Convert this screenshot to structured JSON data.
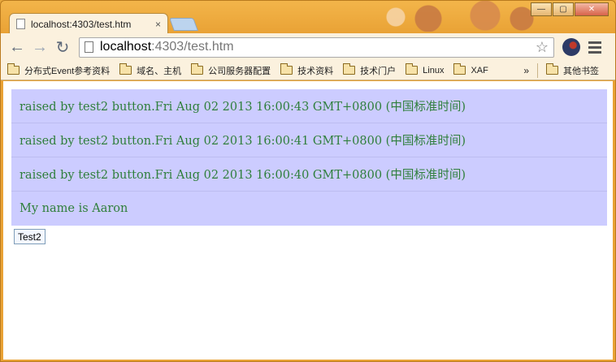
{
  "browser": {
    "tab_title": "localhost:4303/test.htm",
    "tab_close": "×",
    "url_host": "localhost",
    "url_rest": ":4303/test.htm"
  },
  "bookmarks": {
    "items": [
      "分布式Event参考资料",
      "域名、主机",
      "公司服务器配置",
      "技术资料",
      "技术门户",
      "Linux",
      "XAF"
    ],
    "overflow": "»",
    "other": "其他书签"
  },
  "page": {
    "messages": [
      "raised by test2 button.Fri Aug 02 2013 16:00:43 GMT+0800 (中国标准时间)",
      "raised by test2 button.Fri Aug 02 2013 16:00:41 GMT+0800 (中国标准时间)",
      "raised by test2 button.Fri Aug 02 2013 16:00:40 GMT+0800 (中国标准时间)",
      "My name is Aaron"
    ],
    "button_label": "Test2"
  },
  "colors": {
    "message_bg": "#ccccff",
    "message_text": "#2f7f3b",
    "frame": "#e9a235"
  },
  "icons": [
    "page-icon",
    "back-arrow-icon",
    "forward-arrow-icon",
    "reload-icon",
    "document-icon",
    "star-icon",
    "extension-icon",
    "menu-icon",
    "folder-icon"
  ]
}
